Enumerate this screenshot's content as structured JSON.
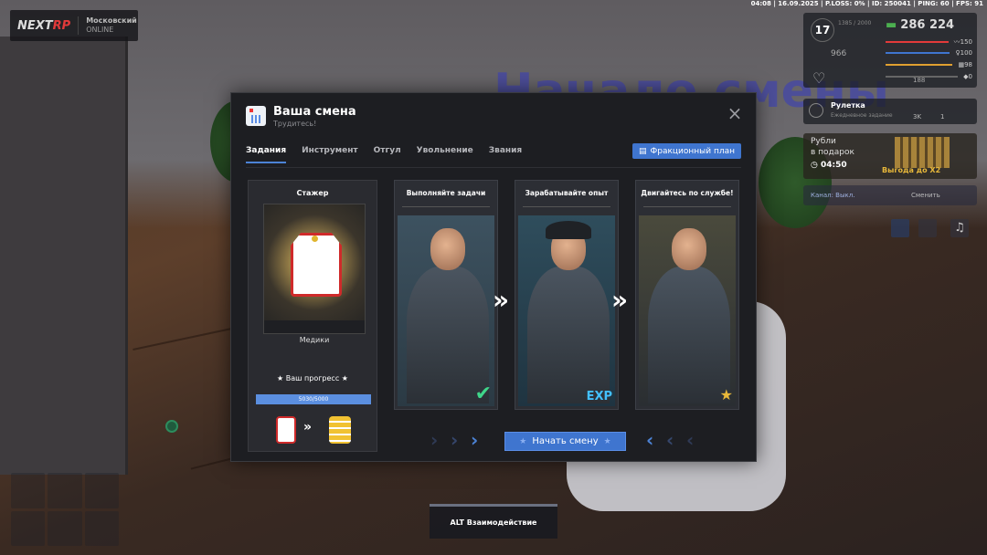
{
  "top_stats": "04:08 | 16.09.2025 | P.LOSS: 0% | ID: 250041 | PING: 60 | FPS: 91",
  "logo": {
    "brand_left": "NEXT",
    "brand_right": "RP",
    "server": "Московский",
    "server_sub": "ONLINE"
  },
  "background": {
    "wall_text": "Начало смены"
  },
  "hud": {
    "level": "17",
    "exp": "1385 / 2000",
    "money": "286 224",
    "health": "150",
    "armor": "100",
    "hunger": "98",
    "extra": "0",
    "wanted": "966",
    "slot_a": "0",
    "slot_b": "188",
    "slot_c": "0"
  },
  "roulette": {
    "title": "Рулетка",
    "sub": "Ежедневное задание",
    "a": "3K",
    "b": "1"
  },
  "gift": {
    "title": "Рубли",
    "title2": "в подарок",
    "timer": "04:50",
    "promo": "Выгода до X2"
  },
  "channel": {
    "label": "Канал: Выкл.",
    "change": "Сменить"
  },
  "modal": {
    "title": "Ваша смена",
    "subtitle": "Трудитесь!",
    "close_glyph": "×",
    "tabs": [
      "Задания",
      "Инструмент",
      "Отгул",
      "Увольнение",
      "Звания"
    ],
    "active_tab": "Задания",
    "plan_button": "Фракционный план",
    "side": {
      "rank": "Стажер",
      "faction": "Медики",
      "progress_title": "★ Ваш прогресс ★",
      "progress_text": "5030/5000",
      "progress_fraction": 1.0
    },
    "cards": [
      {
        "title": "Выполняйте задачи",
        "badge": "✔",
        "badge_type": "check"
      },
      {
        "title": "Зарабатывайте опыт",
        "badge": "EXP",
        "badge_type": "exp"
      },
      {
        "title": "Двигайтесь по службе!",
        "badge": "★",
        "badge_type": "rank"
      }
    ],
    "start_button": "Начать смену",
    "start_star": "★"
  },
  "interaction_hint": "ALT Взаимодействие",
  "colors": {
    "accent": "#3f75cf",
    "panel": "#1d1e22",
    "card": "#2c2e34",
    "danger": "#cf2a2a",
    "success": "#3fd68a"
  }
}
